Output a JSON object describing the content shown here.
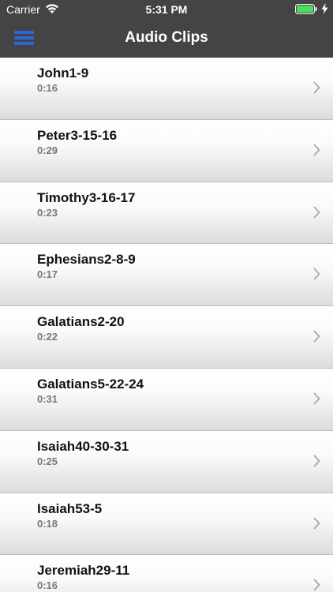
{
  "status_bar": {
    "carrier": "Carrier",
    "time": "5:31 PM",
    "battery_color": "#4cd964"
  },
  "nav_bar": {
    "title": "Audio Clips",
    "menu_icon": "hamburger-menu-icon",
    "accent_color": "#2a66d8"
  },
  "clips": [
    {
      "title": "John1-9",
      "duration": "0:16"
    },
    {
      "title": "Peter3-15-16",
      "duration": "0:29"
    },
    {
      "title": "Timothy3-16-17",
      "duration": "0:23"
    },
    {
      "title": "Ephesians2-8-9",
      "duration": "0:17"
    },
    {
      "title": "Galatians2-20",
      "duration": "0:22"
    },
    {
      "title": "Galatians5-22-24",
      "duration": "0:31"
    },
    {
      "title": "Isaiah40-30-31",
      "duration": "0:25"
    },
    {
      "title": "Isaiah53-5",
      "duration": "0:18"
    },
    {
      "title": "Jeremiah29-11",
      "duration": "0:16"
    }
  ]
}
